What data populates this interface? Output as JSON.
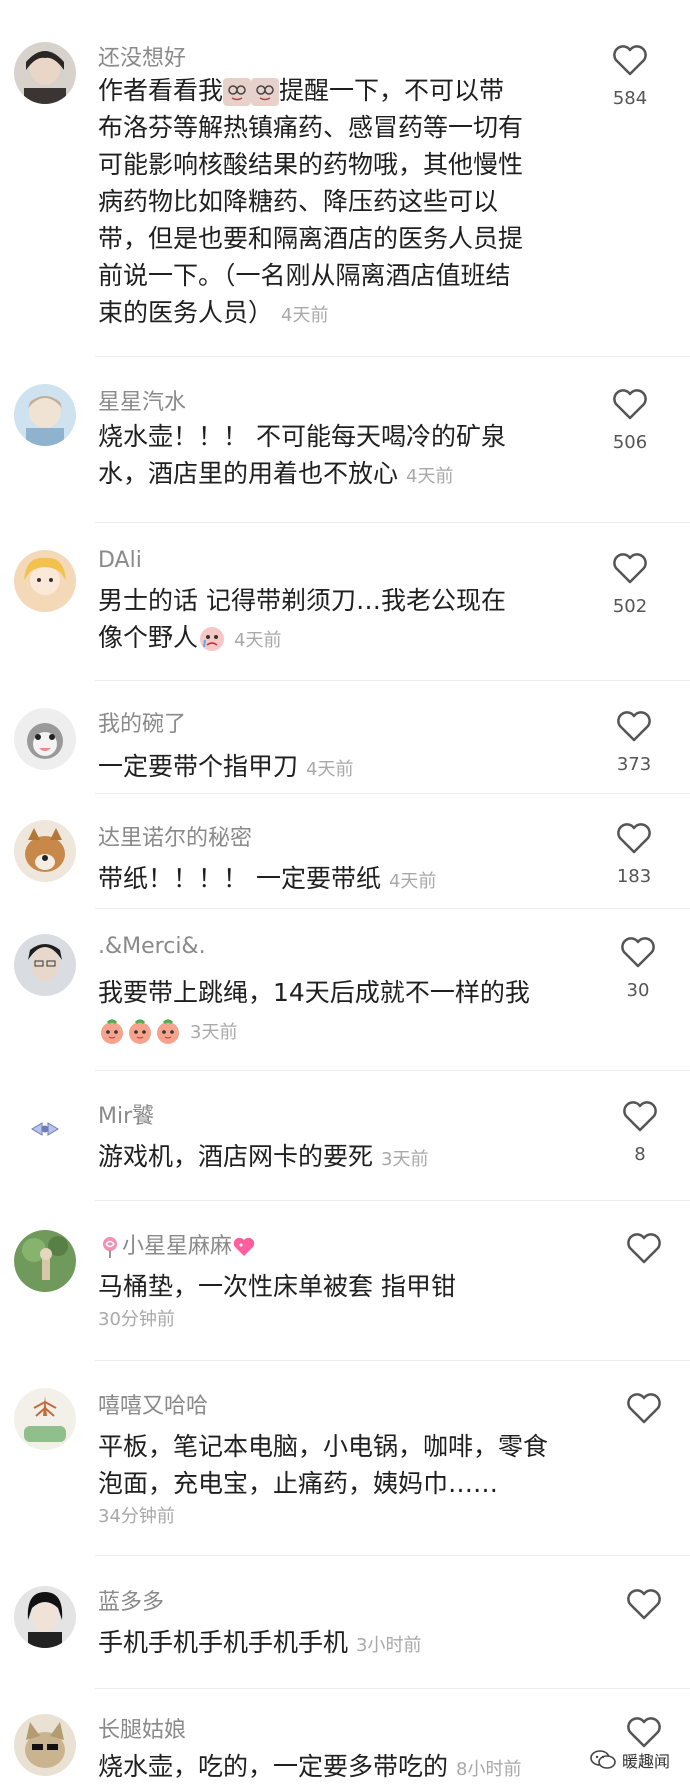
{
  "comments": [
    {
      "user": "还没想好",
      "text": "作者看看我",
      "text2": "提醒一下，不可以带布洛芬等解热镇痛药、感冒药等一切有可能影响核酸结果的药物哦，其他慢性病药物比如降糖药、降压药这些可以带，但是也要和隔离酒店的医务人员提前说一下。（一名刚从隔离酒店值班结束的医务人员）",
      "time": "4天前",
      "likes": "584"
    },
    {
      "user": "星星汽水",
      "text": "烧水壶！！！ 不可能每天喝冷的矿泉水，酒店里的用着也不放心",
      "time": "4天前",
      "likes": "506"
    },
    {
      "user": "DAli",
      "text": "男士的话 记得带剃须刀…我老公现在像个野人",
      "time": "4天前",
      "likes": "502"
    },
    {
      "user": "我的碗了",
      "text": "一定要带个指甲刀",
      "time": "4天前",
      "likes": "373"
    },
    {
      "user": "达里诺尔的秘密",
      "text": "带纸！！！！ 一定要带纸",
      "time": "4天前",
      "likes": "183"
    },
    {
      "user": ".&Merci&.",
      "text": "我要带上跳绳，14天后成就不一样的我",
      "time": "3天前",
      "likes": "30"
    },
    {
      "user": "Mir饕",
      "text": "游戏机，酒店网卡的要死",
      "time": "3天前",
      "likes": "8"
    },
    {
      "user": "小星星麻麻",
      "text": "马桶垫，一次性床单被套 指甲钳",
      "time": "30分钟前",
      "likes": ""
    },
    {
      "user": "嘻嘻又哈哈",
      "text": "平板，笔记本电脑，小电锅，咖啡，零食泡面，充电宝，止痛药，姨妈巾……",
      "time": "34分钟前",
      "likes": ""
    },
    {
      "user": "蓝多多",
      "text": "手机手机手机手机手机",
      "time": "3小时前",
      "likes": ""
    },
    {
      "user": "长腿姑娘",
      "text": "烧水壶，吃的，一定要多带吃的",
      "time": "8小时前",
      "likes": ""
    }
  ],
  "watermark": "暖趣闻",
  "icons": {
    "like": "heart-outline-icon",
    "watermark": "wechat-icon"
  },
  "colors": {
    "username": "#8a8a8a",
    "text": "#1f1f1f",
    "time": "#a9a9a9",
    "divider": "#ededed"
  }
}
